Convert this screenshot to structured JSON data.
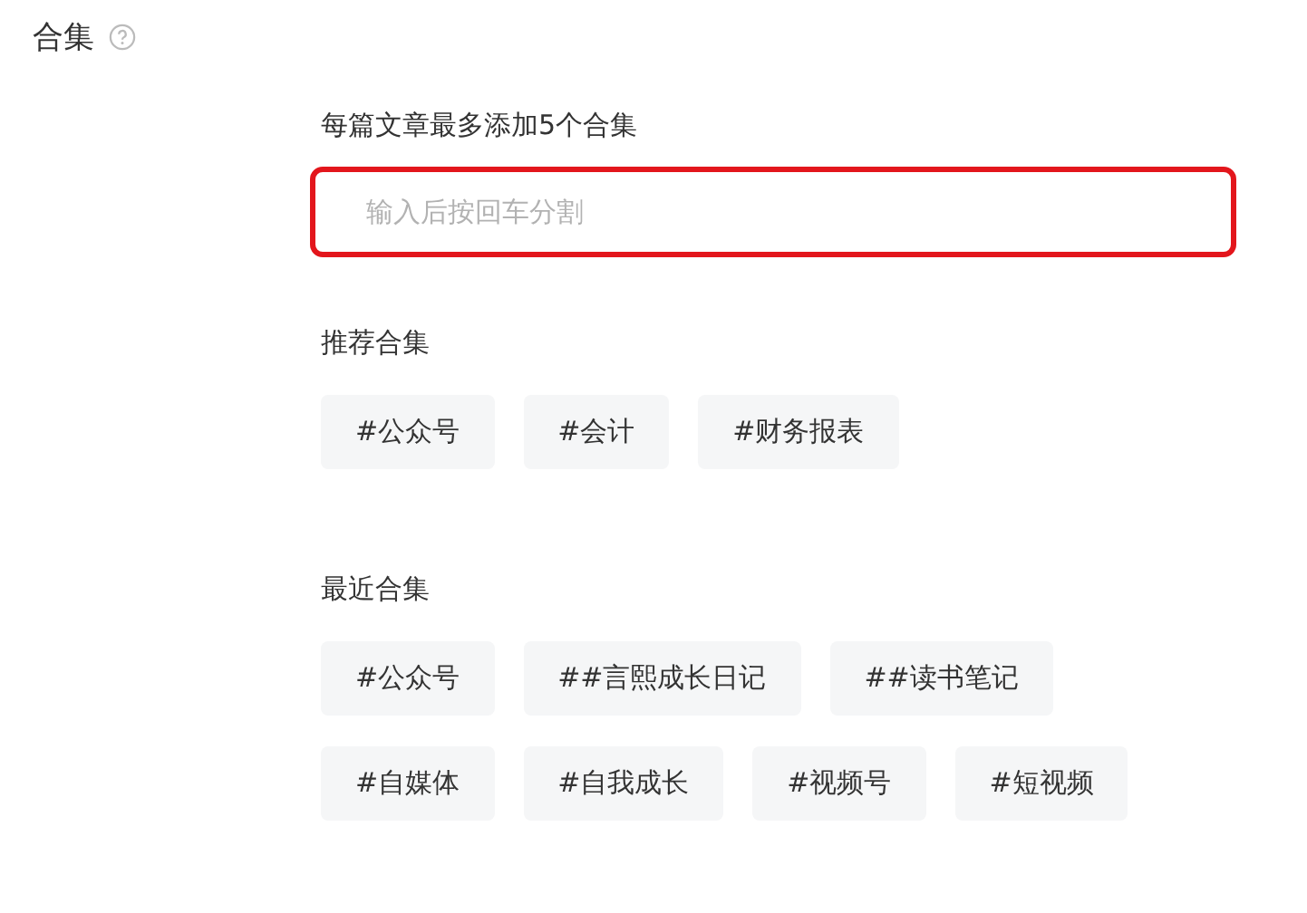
{
  "section": {
    "title": "合集"
  },
  "limit_label": "每篇文章最多添加5个合集",
  "input": {
    "placeholder": "输入后按回车分割"
  },
  "recommended": {
    "title": "推荐合集",
    "tags": [
      "#公众号",
      "#会计",
      "#财务报表"
    ]
  },
  "recent": {
    "title": "最近合集",
    "tags": [
      "#公众号",
      "##言熙成长日记",
      "##读书笔记",
      "#自媒体",
      "#自我成长",
      "#视频号",
      "#短视频"
    ]
  }
}
